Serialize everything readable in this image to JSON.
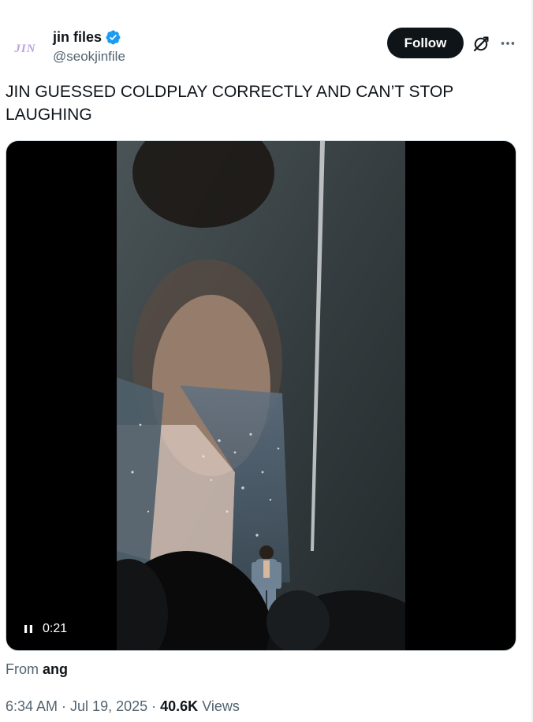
{
  "author": {
    "display_name": "jin files",
    "handle": "@seokjinfile",
    "avatar_text": "JIN",
    "verified": true
  },
  "header": {
    "follow_label": "Follow"
  },
  "tweet": {
    "text": "JIN GUESSED COLDPLAY CORRECTLY AND CAN’T STOP LAUGHING"
  },
  "video": {
    "time": "0:21",
    "state": "playing"
  },
  "from": {
    "prefix": "From",
    "source": "ang"
  },
  "meta": {
    "time": "6:34 AM",
    "separator1": " · ",
    "date": "Jul 19, 2025",
    "separator2": " · ",
    "views_count": "40.6K",
    "views_label": "Views"
  },
  "colors": {
    "accent": "#1d9bf0",
    "text_primary": "#0f1419",
    "text_secondary": "#536471",
    "button_bg": "#0f1419",
    "avatar_text": "#b9a2e2"
  },
  "icons": {
    "verified": "verified-badge-icon",
    "grok": "grok-icon",
    "more": "more-options-icon",
    "pause": "pause-icon"
  }
}
